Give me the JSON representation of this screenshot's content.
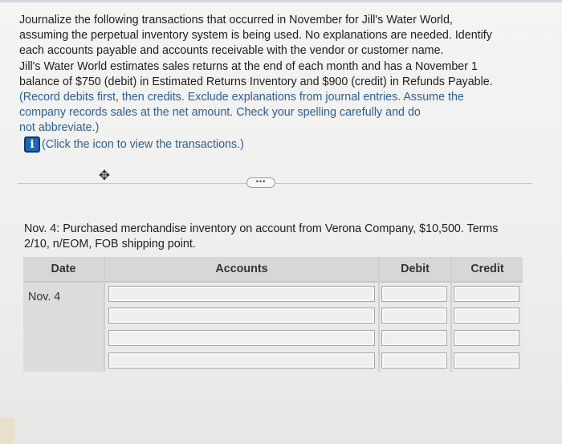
{
  "instructions": {
    "line1": "Journalize the following transactions that occurred in November for Jill's Water World,",
    "line2": "assuming the perpetual inventory system is being used. No explanations are needed. Identify",
    "line3": "each accounts payable and accounts receivable with the vendor or customer name.",
    "line4": "Jill's Water World estimates sales returns at the end of each month and has a November 1",
    "line5": "balance of $750 (debit) in Estimated Returns Inventory and $900 (credit) in Refunds Payable.",
    "line6": "(Record debits first, then credits. Exclude explanations from journal entries. Assume the",
    "line7": "company records sales at the net amount. Check your spelling carefully and do",
    "line8": "not abbreviate.)"
  },
  "info_link": {
    "icon": "info-icon",
    "icon_glyph": "i",
    "label": "(Click the icon to view the transactions.)"
  },
  "toolbar": {
    "move_icon": "move-icon",
    "more_label": "•••"
  },
  "transaction": {
    "line1": "Nov. 4: Purchased merchandise inventory on account from Verona Company, $10,500. Terms",
    "line2": "2/10, n/EOM, FOB shipping point."
  },
  "journal": {
    "headers": {
      "date": "Date",
      "accounts": "Accounts",
      "debit": "Debit",
      "credit": "Credit"
    },
    "date_value": "Nov. 4",
    "rows": [
      {
        "account": "",
        "debit": "",
        "credit": ""
      },
      {
        "account": "",
        "debit": "",
        "credit": ""
      },
      {
        "account": "",
        "debit": "",
        "credit": ""
      },
      {
        "account": "",
        "debit": "",
        "credit": ""
      }
    ]
  },
  "colors": {
    "info_icon": "#1f66b3",
    "instruction_note": "#2e5f9a"
  }
}
